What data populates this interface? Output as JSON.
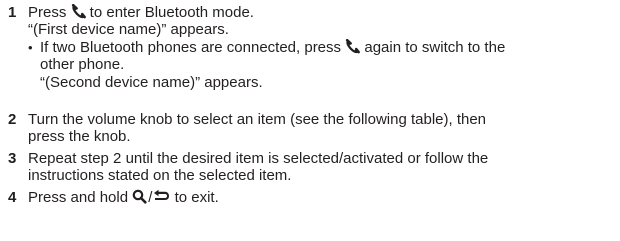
{
  "steps": [
    {
      "number": "1",
      "text_before_icon": "Press ",
      "text_after_icon": " to enter Bluetooth mode.",
      "icon": "phone-icon",
      "note": "“(First device name)” appears.",
      "bullet": {
        "line1_before_icon": "If two Bluetooth phones are connected, press ",
        "line1_after_icon": " again to switch to the",
        "icon": "phone-icon",
        "line2": "other phone.",
        "line3": "“(Second device name)” appears."
      }
    },
    {
      "number": "2",
      "line1": "Turn the volume knob to select an item (see the following table), then",
      "line2": "press the knob."
    },
    {
      "number": "3",
      "line1": "Repeat step 2 until the desired item is selected/activated or follow the",
      "line2": "instructions stated on the selected item."
    },
    {
      "number": "4",
      "text_before_icon": "Press and hold ",
      "icon1": "search-icon",
      "separator": "/",
      "icon2": "back-arrow-icon",
      "text_after_icon": " to exit."
    }
  ],
  "colors": {
    "text": "#231f20"
  }
}
